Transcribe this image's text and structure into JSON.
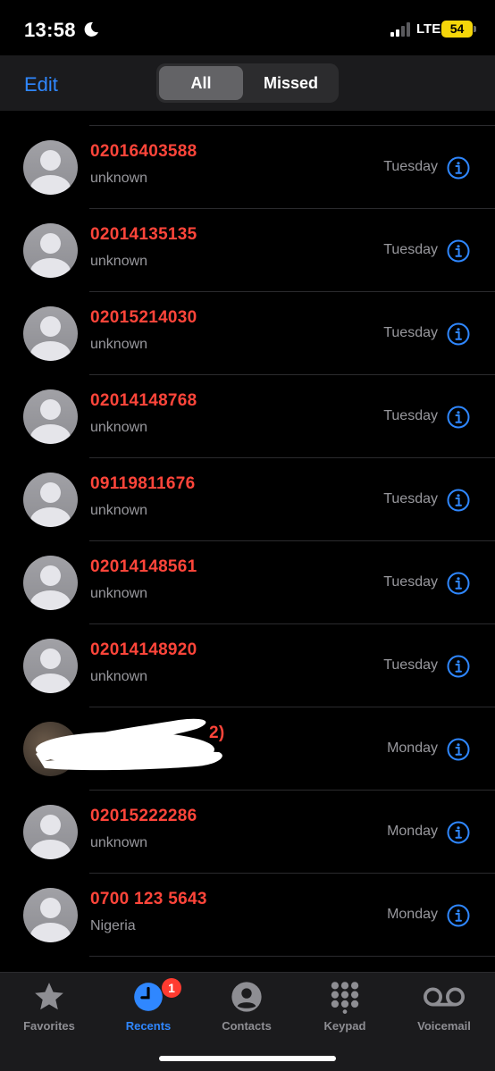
{
  "status": {
    "time": "13:58",
    "network": "LTE",
    "battery": "54"
  },
  "header": {
    "edit": "Edit",
    "segments": [
      "All",
      "Missed"
    ]
  },
  "calls": [
    {
      "number": "02016403588",
      "sub": "unknown",
      "day": "Tuesday"
    },
    {
      "number": "02014135135",
      "sub": "unknown",
      "day": "Tuesday"
    },
    {
      "number": "02015214030",
      "sub": "unknown",
      "day": "Tuesday"
    },
    {
      "number": "02014148768",
      "sub": "unknown",
      "day": "Tuesday"
    },
    {
      "number": "09119811676",
      "sub": "unknown",
      "day": "Tuesday"
    },
    {
      "number": "02014148561",
      "sub": "unknown",
      "day": "Tuesday"
    },
    {
      "number": "02014148920",
      "sub": "unknown",
      "day": "Tuesday"
    },
    {
      "number": "2)",
      "sub": "",
      "day": "Monday"
    },
    {
      "number": "02015222286",
      "sub": "unknown",
      "day": "Monday"
    },
    {
      "number": "0700 123 5643",
      "sub": "Nigeria",
      "day": "Monday"
    }
  ],
  "tabs": [
    {
      "label": "Favorites",
      "icon": "star-icon"
    },
    {
      "label": "Recents",
      "icon": "clock-icon",
      "badge": "1"
    },
    {
      "label": "Contacts",
      "icon": "person-icon"
    },
    {
      "label": "Keypad",
      "icon": "keypad-icon"
    },
    {
      "label": "Voicemail",
      "icon": "voicemail-icon"
    }
  ],
  "colors": {
    "accent": "#2f87ff",
    "missed": "#ff453a",
    "badge": "#ff3b30"
  }
}
